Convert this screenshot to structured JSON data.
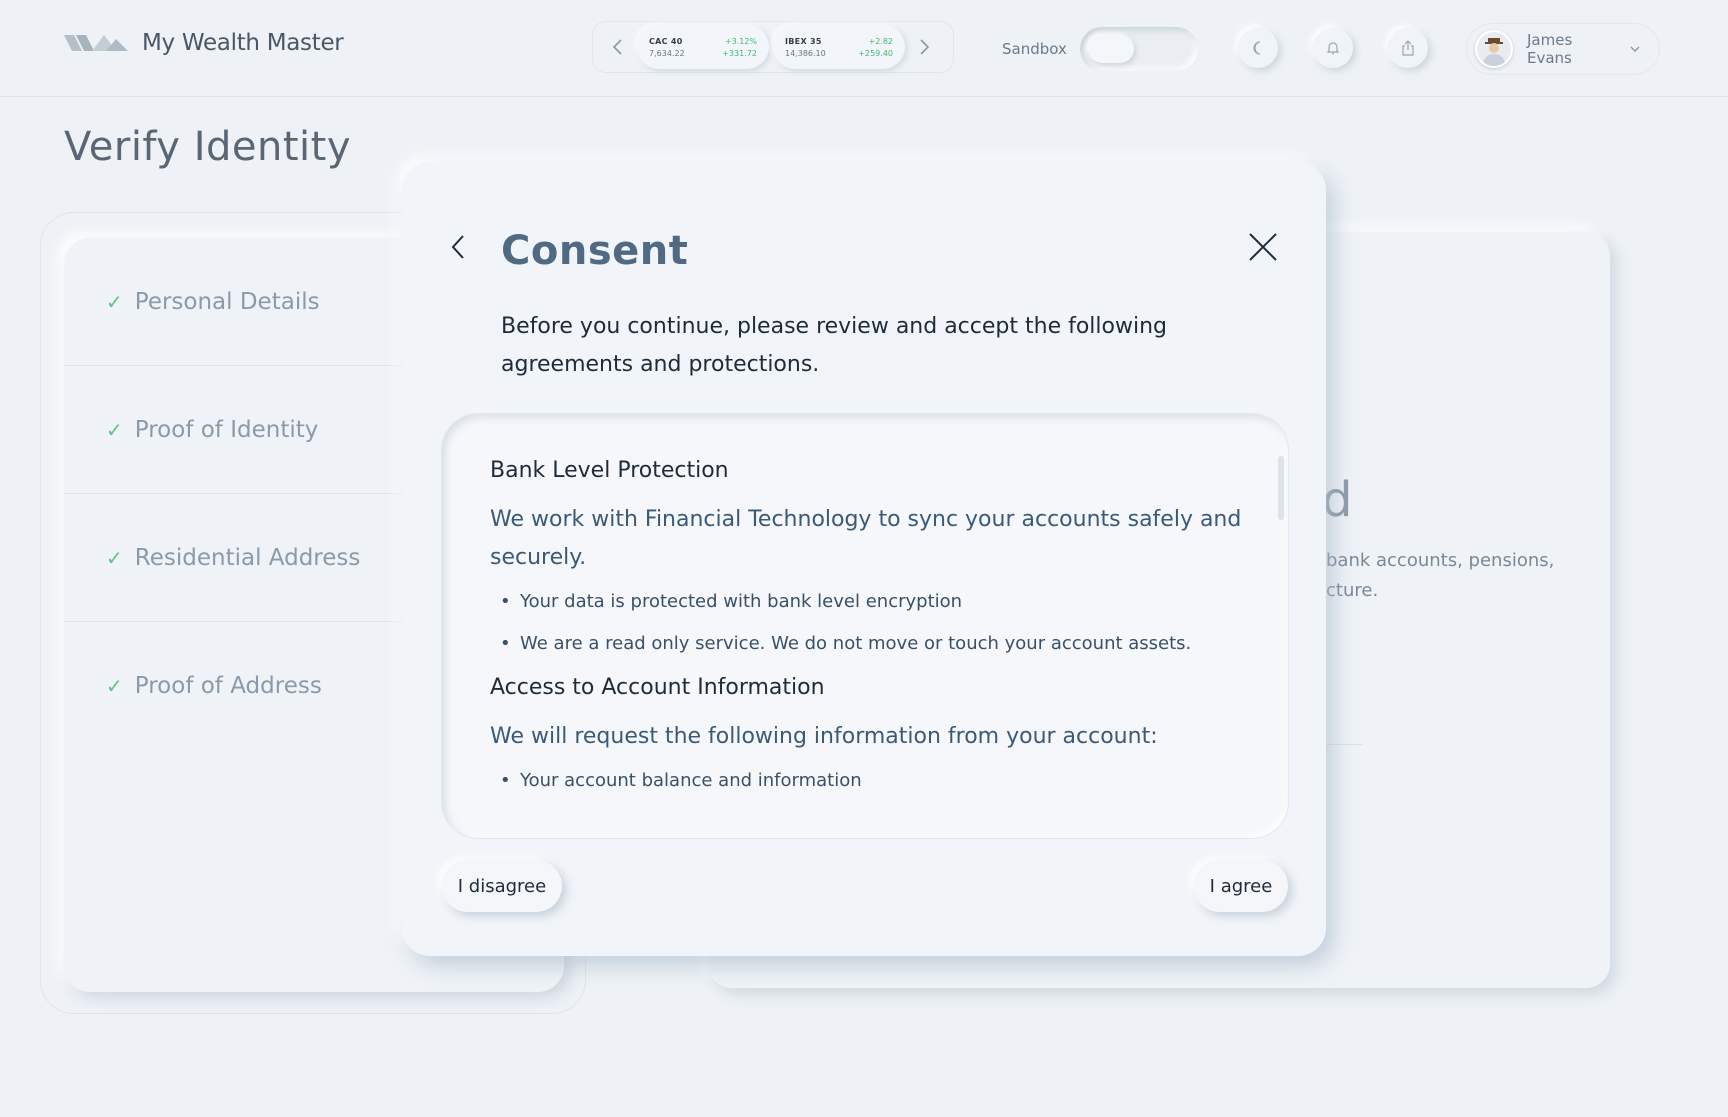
{
  "app": {
    "name": "My Wealth Master"
  },
  "ticker": {
    "items": [
      {
        "name": "CAC 40",
        "value": "7,634.22",
        "change_pct": "+3.12%",
        "change_abs": "+331.72"
      },
      {
        "name": "IBEX 35",
        "value": "14,386.10",
        "change_pct": "+2.82",
        "change_abs": "+259.40"
      }
    ]
  },
  "header": {
    "sandbox_label": "Sandbox",
    "user_name": "James Evans"
  },
  "page": {
    "title": "Verify Identity"
  },
  "steps": [
    {
      "label": "Personal Details",
      "done": true
    },
    {
      "label": "Proof of Identity",
      "done": true
    },
    {
      "label": "Residential Address",
      "done": true
    },
    {
      "label": "Proof of Address",
      "done": true
    }
  ],
  "background_card": {
    "big_text": "d",
    "line1": "bank accounts, pensions,",
    "line2": "cture."
  },
  "modal": {
    "title": "Consent",
    "intro": "Before you continue, please review and accept the following agreements and protections.",
    "sections": [
      {
        "heading": "Bank Level Protection",
        "description": "We work with Financial Technology to sync your accounts safely and securely.",
        "bullets": [
          "Your data is protected with bank level encryption",
          "We are a read only service. We do not move or touch your account assets."
        ]
      },
      {
        "heading": "Access to Account Information",
        "description": "We will request the following information from your account:",
        "bullets": [
          "Your account balance and information"
        ]
      }
    ],
    "disagree_label": "I disagree",
    "agree_label": "I agree"
  },
  "colors": {
    "background": "#eef2f6",
    "accent_title": "#4f6a82",
    "positive": "#3fb970",
    "check": "#5cc58a"
  }
}
